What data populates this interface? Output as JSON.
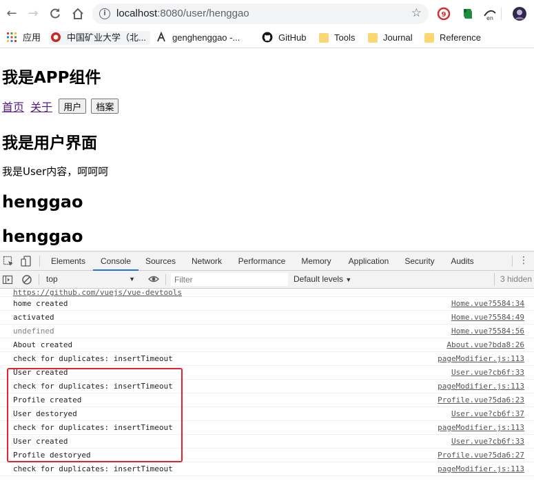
{
  "browser": {
    "url_host": "localhost",
    "url_path": ":8080/user/henggao",
    "bookmarks": [
      {
        "label": "应用",
        "icon": "apps-grid-icon"
      },
      {
        "label": "中国矿业大学（北...",
        "icon": "university-logo-icon"
      },
      {
        "label": "genghenggao -...",
        "icon": "site-logo-icon"
      },
      {
        "label": "GitHub",
        "icon": "github-icon"
      },
      {
        "label": "Tools",
        "icon": "folder-icon"
      },
      {
        "label": "Journal",
        "icon": "folder-icon"
      },
      {
        "label": "Reference",
        "icon": "folder-icon"
      }
    ]
  },
  "page": {
    "app_heading": "我是APP组件",
    "nav_links": [
      "首页",
      "关于"
    ],
    "nav_buttons": [
      "用户",
      "档案"
    ],
    "user_heading": "我是用户界面",
    "user_text": "我是User内容，呵呵呵",
    "name_heading_1": "henggao",
    "name_heading_2": "henggao"
  },
  "devtools": {
    "tabs": [
      "Elements",
      "Console",
      "Sources",
      "Network",
      "Performance",
      "Memory",
      "Application",
      "Security",
      "Audits"
    ],
    "active_tab": "Console",
    "context": "top",
    "filter_placeholder": "Filter",
    "levels": "Default levels",
    "hidden": "3 hidden",
    "top_link": "https://github.com/vuejs/vue-devtools",
    "logs": [
      {
        "msg": "home created",
        "src": "Home.vue?5584:34"
      },
      {
        "msg": "activated",
        "src": "Home.vue?5584:49"
      },
      {
        "msg": "undefined",
        "src": "Home.vue?5584:56"
      },
      {
        "msg": "About created",
        "src": "About.vue?bda8:26"
      },
      {
        "msg": "check for duplicates: insertTimeout",
        "src": "pageModifier.js:113"
      },
      {
        "msg": "User created",
        "src": "User.vue?cb6f:33"
      },
      {
        "msg": "check for duplicates: insertTimeout",
        "src": "pageModifier.js:113"
      },
      {
        "msg": "Profile created",
        "src": "Profile.vue?5da6:23"
      },
      {
        "msg": "User destoryed",
        "src": "User.vue?cb6f:37"
      },
      {
        "msg": "check for duplicates: insertTimeout",
        "src": "pageModifier.js:113"
      },
      {
        "msg": "User created",
        "src": "User.vue?cb6f:33"
      },
      {
        "msg": "Profile destoryed",
        "src": "Profile.vue?5da6:27"
      },
      {
        "msg": "check for duplicates: insertTimeout",
        "src": "pageModifier.js:113"
      }
    ]
  },
  "colors": {
    "highlight_box": "#e8212b",
    "active_tab_underline": "#1a73e8",
    "visited_link": "#551a8b"
  }
}
